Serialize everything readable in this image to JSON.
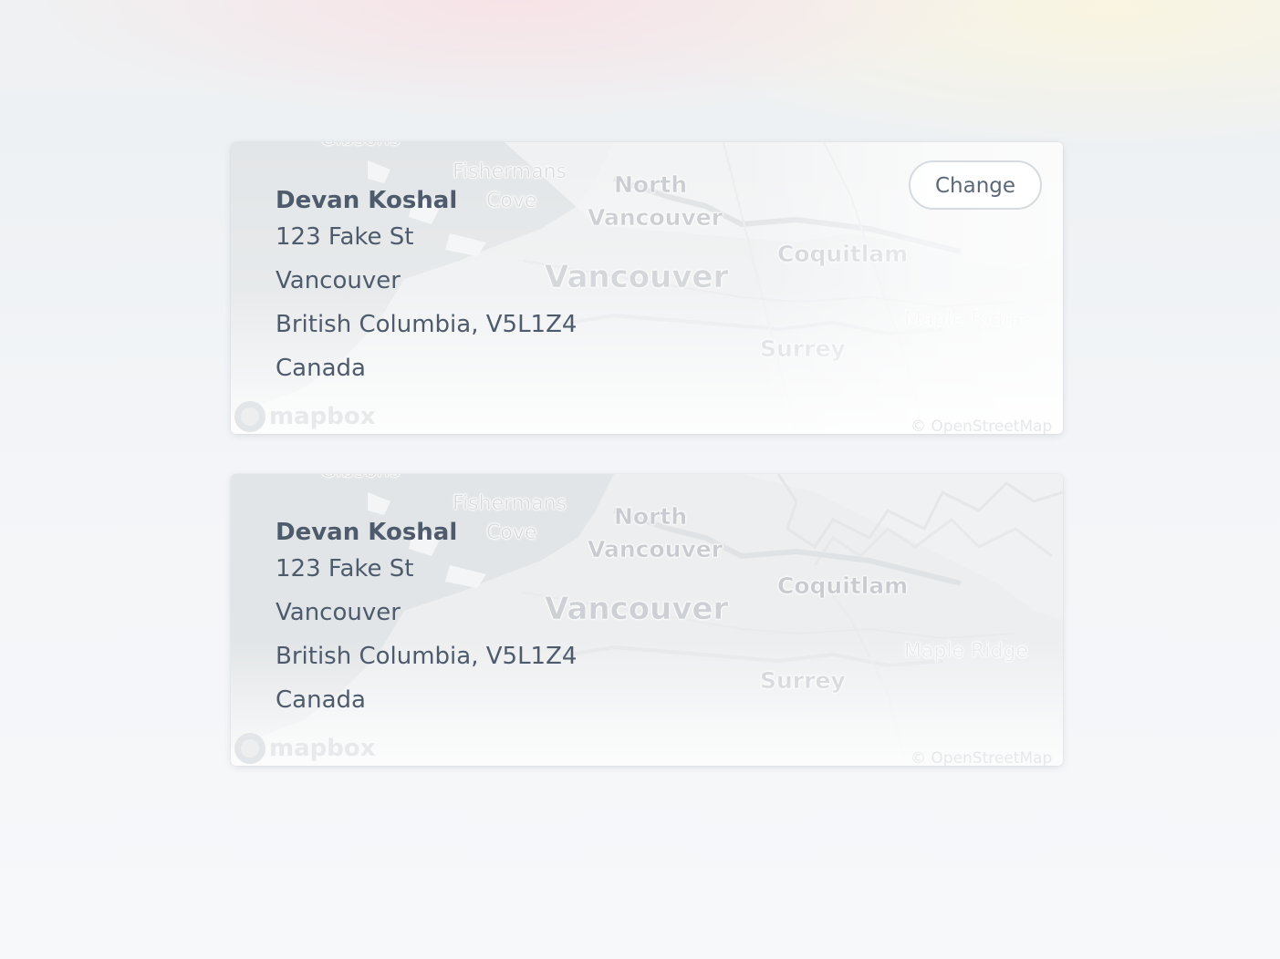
{
  "cards": [
    {
      "name": "Devan Koshal",
      "street": "123 Fake St",
      "city": "Vancouver",
      "region_postal": "British Columbia, V5L1Z4",
      "country": "Canada",
      "change_label": "Change"
    },
    {
      "name": "Devan Koshal",
      "street": "123 Fake St",
      "city": "Vancouver",
      "region_postal": "British Columbia, V5L1Z4",
      "country": "Canada"
    }
  ],
  "map": {
    "labels": {
      "gibsons": "Gibsons",
      "fishermans": "Fishermans",
      "cove": "Cove",
      "north": "North",
      "north_vancouver": "Vancouver",
      "vancouver": "Vancouver",
      "coquitlam": "Coquitlam",
      "maple_ridge": "Maple Ridge",
      "surrey": "Surrey"
    },
    "logo_text": "mapbox",
    "attribution": "© OpenStreetMap"
  },
  "colors": {
    "text": "#4e5b6c",
    "button_border": "#d6dbe0"
  }
}
